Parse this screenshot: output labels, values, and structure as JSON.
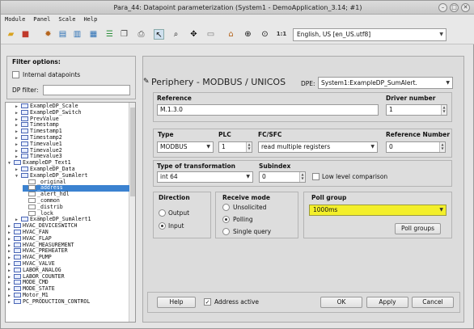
{
  "window": {
    "title": "Para_44: Datapoint parameterization (System1 - DemoApplication_3.14; #1)",
    "minimize": "–",
    "maximize": "□",
    "close": "✕"
  },
  "menu": [
    "Module",
    "Panel",
    "Scale",
    "Help"
  ],
  "toolbar": {
    "icons": [
      "folder-open",
      "close",
      "settings",
      "export",
      "import",
      "print",
      "cursor",
      "zoom",
      "move",
      "frame",
      "home",
      "search-zoom",
      "zoom-in"
    ],
    "scale_label": "1:1",
    "language": "English, US [en_US.utf8]"
  },
  "filter": {
    "title": "Filter options:",
    "internal_label": "Internal datapoints",
    "dp_filter_label": "DP filter:",
    "dp_filter_value": ""
  },
  "tree": [
    {
      "depth": 1,
      "toggle": "▶",
      "label": "ExampleDP_Scale",
      "type": "dp"
    },
    {
      "depth": 1,
      "toggle": "▶",
      "label": "ExampleDP_Switch",
      "type": "dp"
    },
    {
      "depth": 1,
      "toggle": "▶",
      "label": "PrevValue",
      "type": "dp"
    },
    {
      "depth": 1,
      "toggle": "▶",
      "label": "Timestamp",
      "type": "dp"
    },
    {
      "depth": 1,
      "toggle": "▶",
      "label": "Timestamp1",
      "type": "dp"
    },
    {
      "depth": 1,
      "toggle": "▶",
      "label": "Timestamp2",
      "type": "dp"
    },
    {
      "depth": 1,
      "toggle": "▶",
      "label": "Timevalue1",
      "type": "dp"
    },
    {
      "depth": 1,
      "toggle": "▶",
      "label": "Timevalue2",
      "type": "dp"
    },
    {
      "depth": 1,
      "toggle": "▶",
      "label": "Timevalue3",
      "type": "dp"
    },
    {
      "depth": 0,
      "toggle": "▼",
      "label": "ExampleDP_Text1",
      "type": "dp"
    },
    {
      "depth": 1,
      "toggle": "▶",
      "label": "ExampleDP_Data",
      "type": "dp"
    },
    {
      "depth": 1,
      "toggle": "▼",
      "label": "ExampleDP_SumAlert",
      "type": "dp"
    },
    {
      "depth": 2,
      "toggle": "",
      "label": "_original",
      "type": "config"
    },
    {
      "depth": 2,
      "toggle": "",
      "label": "_address",
      "type": "config",
      "selected": true
    },
    {
      "depth": 2,
      "toggle": "",
      "label": "_alert_hdl",
      "type": "config"
    },
    {
      "depth": 2,
      "toggle": "",
      "label": "_common",
      "type": "config"
    },
    {
      "depth": 2,
      "toggle": "",
      "label": "_distrib",
      "type": "config"
    },
    {
      "depth": 2,
      "toggle": "",
      "label": "_lock",
      "type": "config"
    },
    {
      "depth": 1,
      "toggle": "▶",
      "label": "ExampleDP_SumAlert1",
      "type": "dp"
    },
    {
      "depth": 0,
      "toggle": "▶",
      "label": "HVAC_DEVICESWITCH",
      "type": "dp"
    },
    {
      "depth": 0,
      "toggle": "▶",
      "label": "HVAC_FAN",
      "type": "dp"
    },
    {
      "depth": 0,
      "toggle": "▶",
      "label": "HVAC_FLAP",
      "type": "dp"
    },
    {
      "depth": 0,
      "toggle": "▶",
      "label": "HVAC_MEASUREMENT",
      "type": "dp"
    },
    {
      "depth": 0,
      "toggle": "▶",
      "label": "HVAC_PREHEATER",
      "type": "dp"
    },
    {
      "depth": 0,
      "toggle": "▶",
      "label": "HVAC_PUMP",
      "type": "dp"
    },
    {
      "depth": 0,
      "toggle": "▶",
      "label": "HVAC_VALVE",
      "type": "dp"
    },
    {
      "depth": 0,
      "toggle": "▶",
      "label": "LABOR_ANALOG",
      "type": "dp"
    },
    {
      "depth": 0,
      "toggle": "▶",
      "label": "LABOR_COUNTER",
      "type": "dp"
    },
    {
      "depth": 0,
      "toggle": "▶",
      "label": "MODE_CMD",
      "type": "dp"
    },
    {
      "depth": 0,
      "toggle": "▶",
      "label": "MODE_STATE",
      "type": "dp"
    },
    {
      "depth": 0,
      "toggle": "▶",
      "label": "Motor_M1",
      "type": "dp"
    },
    {
      "depth": 0,
      "toggle": "▶",
      "label": "PC_PRODUCTION_CONTROL",
      "type": "dp"
    }
  ],
  "panel": {
    "title": "Periphery - MODBUS / UNICOS",
    "dpe_label": "DPE:",
    "dpe_value": "System1:ExampleDP_SumAlert.",
    "reference_label": "Reference",
    "reference_value": "M.1.3.0",
    "driver_label": "Driver number",
    "driver_value": "1",
    "type_label": "Type",
    "type_value": "MODBUS",
    "plc_label": "PLC",
    "plc_value": "1",
    "fc_label": "FC/SFC",
    "fc_value": "read multiple registers",
    "refnum_label": "Reference Number",
    "refnum_value": "0",
    "transform_label": "Type of transformation",
    "transform_value": "int 64",
    "subindex_label": "Subindex",
    "subindex_value": "0",
    "lowlevel_label": "Low level comparison",
    "direction_label": "Direction",
    "direction_options": [
      "Output",
      "Input"
    ],
    "receive_label": "Receive mode",
    "receive_options": [
      "Unsolicited",
      "Polling",
      "Single query"
    ],
    "pollgroup_label": "Poll group",
    "pollgroup_value": "1000ms",
    "pollgroups_button": "Poll groups"
  },
  "footer": {
    "help": "Help",
    "address_active": "Address active",
    "ok": "OK",
    "apply": "Apply",
    "cancel": "Cancel"
  },
  "colors": {
    "highlight": "#f3ef2a",
    "selection": "#3b82d0"
  }
}
